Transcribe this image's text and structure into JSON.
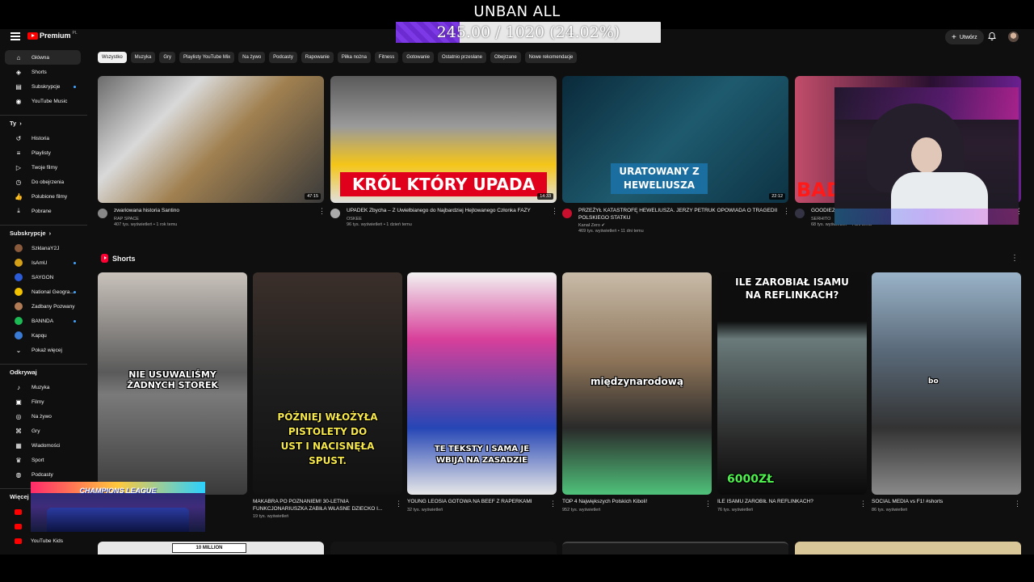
{
  "overlay": {
    "title": "UNBAN ALL",
    "progress_text": "245.00 / 1020 (24.02%)",
    "progress_fraction": 0.2402,
    "champions_text": "CHAMPIONS LEAGUE"
  },
  "masthead": {
    "logo_text": "Premium",
    "country": "PL",
    "create_label": "Utwórz"
  },
  "sidebar": {
    "main": [
      {
        "label": "Główna",
        "icon": "home-icon",
        "glyph": "⌂",
        "active": true
      },
      {
        "label": "Shorts",
        "icon": "shorts-icon",
        "glyph": "◈"
      },
      {
        "label": "Subskrypcje",
        "icon": "subscriptions-icon",
        "glyph": "▤",
        "dot": true
      },
      {
        "label": "YouTube Music",
        "icon": "music-icon",
        "glyph": "◉"
      }
    ],
    "you_heading": "Ty",
    "you": [
      {
        "label": "Historia",
        "icon": "history-icon",
        "glyph": "↺"
      },
      {
        "label": "Playlisty",
        "icon": "playlist-icon",
        "glyph": "≡"
      },
      {
        "label": "Twoje filmy",
        "icon": "your-videos-icon",
        "glyph": "▷"
      },
      {
        "label": "Do obejrzenia",
        "icon": "watch-later-icon",
        "glyph": "◷"
      },
      {
        "label": "Polubione filmy",
        "icon": "like-icon",
        "glyph": "👍"
      },
      {
        "label": "Pobrane",
        "icon": "download-icon",
        "glyph": "⤓"
      }
    ],
    "subs_heading": "Subskrypcje",
    "subs": [
      {
        "label": "SzklanaY2J",
        "color": "#8a5a3c"
      },
      {
        "label": "IsAmU",
        "color": "#d4a017",
        "dot": true
      },
      {
        "label": "SAYGON",
        "color": "#2c5bd8"
      },
      {
        "label": "National Geogra...",
        "color": "#f2c200",
        "dot": true
      },
      {
        "label": "Zadbany Pozwany",
        "color": "#b07b55"
      },
      {
        "label": "BANNDA",
        "color": "#1db954",
        "dot": true
      },
      {
        "label": "Kapqu",
        "color": "#3a7bd5"
      },
      {
        "label": "Pokaż więcej",
        "chevron": true
      }
    ],
    "explore_heading": "Odkrywaj",
    "explore": [
      {
        "label": "Muzyka",
        "icon": "music-note-icon",
        "glyph": "♪"
      },
      {
        "label": "Filmy",
        "icon": "film-icon",
        "glyph": "▣"
      },
      {
        "label": "Na żywo",
        "icon": "live-icon",
        "glyph": "◎"
      },
      {
        "label": "Gry",
        "icon": "gamepad-icon",
        "glyph": "⌘"
      },
      {
        "label": "Wiadomości",
        "icon": "news-icon",
        "glyph": "▦"
      },
      {
        "label": "Sport",
        "icon": "trophy-icon",
        "glyph": "♛"
      },
      {
        "label": "Podcasty",
        "icon": "podcast-icon",
        "glyph": "◍"
      }
    ],
    "more_heading": "Więcej z Y",
    "more": [
      {
        "label": "Y",
        "color": "#ff0000"
      },
      {
        "label": "Y",
        "color": "#ff0000"
      },
      {
        "label": "YouTube Kids",
        "color": "#ff0000"
      }
    ]
  },
  "chips": [
    "Wszystko",
    "Muzyka",
    "Gry",
    "Playlisty YouTube Mix",
    "Na żywo",
    "Podcasty",
    "Rapowanie",
    "Piłka nożna",
    "Fitness",
    "Gotowanie",
    "Ostatnio przesłane",
    "Obejrzane",
    "Nowe rekomendacje"
  ],
  "videos": [
    {
      "title": "zwariowana historia Santino",
      "channel": "RAP SPACE",
      "stats": "407 tys. wyświetleń • 1 rok temu",
      "duration": "47:15",
      "thumb_text": "",
      "color": "#2a2a2a"
    },
    {
      "title": "UPADEK Zbycha – Z Uwielbianego do Najbardziej Hejtowanego Członka FAZY",
      "channel": "OSKEE",
      "stats": "96 tys. wyświetleń • 1 dzień temu",
      "duration": "14:33",
      "thumb_text": "KRÓL KTÓRY UPADA",
      "color": "#3b3b3b"
    },
    {
      "title": "PRZEŻYŁ KATASTROFĘ HEWELIUSZA. JERZY PETRUK OPOWIADA O TRAGEDII POLSKIEGO STATKU",
      "channel": "Kanał Zero ✔",
      "stats": "469 tys. wyświetleń • 11 dni temu",
      "duration": "22:12",
      "thumb_text": "URATOWANY Z HEWELIUSZA",
      "color": "#0e3a4a"
    },
    {
      "title": "GOODIEZ...",
      "channel": "SERHITO",
      "stats": "68 tys. wyświetleń • 4 dni temu",
      "duration": "",
      "thumb_text": "BAD",
      "color": "#4a1a3a"
    }
  ],
  "shorts_heading": "Shorts",
  "shorts": [
    {
      "title": "",
      "stats": "",
      "caption": "NIE USUWALIŚMY ŻADNYCH STOREK",
      "color": "#3a3a3a"
    },
    {
      "title": "MAKABRA PO POZNANIEM! 30-LETNIA FUNKCJONARIUSZKA ZABIŁA WŁASNE DZIECKO I...",
      "stats": "19 tys. wyświetleń",
      "caption": "PÓŹNIEJ WŁOŻYŁA PISTOLETY DO UST I NACISNĘŁA SPUST.",
      "color": "#2b2b2b"
    },
    {
      "title": "YOUNG LEOSIA GOTOWA NA BEEF Z RAPERKAMI",
      "stats": "32 tys. wyświetleń",
      "caption": "TE TEKSTY I SAMA JE WBIJA NA ZASADZIE",
      "color": "#1b3c8a"
    },
    {
      "title": "TOP 4 Największych Polskich Kiboli!",
      "stats": "952 tys. wyświetleń",
      "caption": "międzynarodową",
      "color": "#3f3a33"
    },
    {
      "title": "ILE ISAMU ZAROBIŁ NA REFLINKACH?",
      "stats": "76 tys. wyświetleń",
      "caption": "ILE ZAROBIAŁ ISAMU NA REFLINKACH?",
      "caption2": "6000ZŁ",
      "color": "#2a3a2a"
    },
    {
      "title": "SOCIAL MEDIA vs F1! #shorts",
      "stats": "86 tys. wyświetleń",
      "caption": "bo",
      "color": "#4a5a6a"
    }
  ],
  "bottom_row_text": "10 MILLION"
}
